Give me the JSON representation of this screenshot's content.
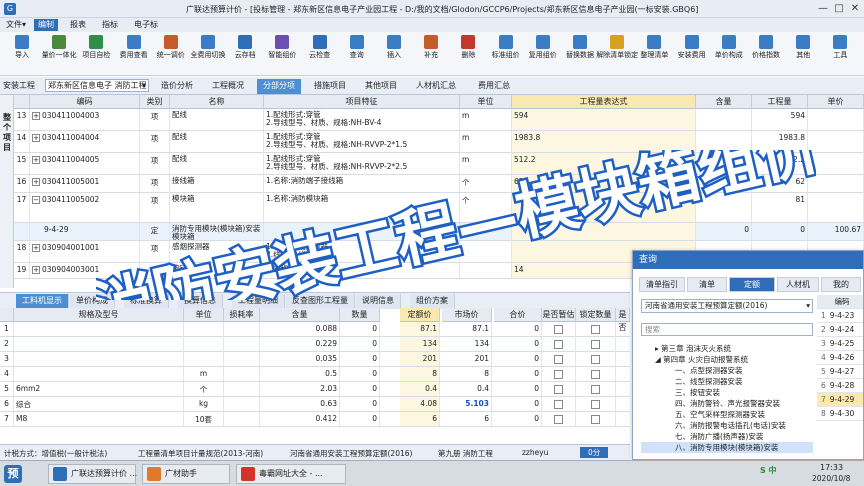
{
  "titlebar": {
    "title": "广联达预算计价 - [投标管理 - 郑东新区信息电子产业园工程 - D:/我的文档/Glodon/GCCP6/Projects/郑东新区信息电子产业园(一标安装.GBQ6]",
    "min": "—",
    "max": "□",
    "close": "✕"
  },
  "menu": [
    "文件▾",
    "编制",
    "报表",
    "指标",
    "电子标"
  ],
  "toolbar": [
    {
      "label": "导入",
      "icon": "import-icon",
      "color": "#3b7cc7"
    },
    {
      "label": "量价一体化",
      "icon": "integration-icon",
      "color": "#4a8a3c"
    },
    {
      "label": "项目自检",
      "icon": "check-icon",
      "color": "#2f8f46"
    },
    {
      "label": "费用查看",
      "icon": "view-icon",
      "color": "#3b7cc7"
    },
    {
      "label": "统一调价",
      "icon": "price-icon",
      "color": "#c55a2a"
    },
    {
      "label": "全费用切换",
      "icon": "switch-icon",
      "color": "#3b7cc7"
    },
    {
      "label": "云存档",
      "icon": "cloud-save-icon",
      "color": "#2f6db8"
    },
    {
      "label": "智能组价",
      "icon": "smart-icon",
      "color": "#6a4fb5"
    },
    {
      "label": "云检查",
      "icon": "cloud-check-icon",
      "color": "#2f6db8"
    },
    {
      "label": "查询",
      "icon": "query-icon",
      "color": "#3b7cc7"
    },
    {
      "label": "插入",
      "icon": "insert-icon",
      "color": "#3b7cc7"
    },
    {
      "label": "补充",
      "icon": "supplement-icon",
      "color": "#c55a2a"
    },
    {
      "label": "删除",
      "icon": "delete-icon",
      "color": "#c0392b"
    },
    {
      "label": "标准组价",
      "icon": "standard-icon",
      "color": "#3b7cc7"
    },
    {
      "label": "复用组价",
      "icon": "reuse-icon",
      "color": "#3b7cc7"
    },
    {
      "label": "替换数据",
      "icon": "replace-icon",
      "color": "#3b7cc7"
    },
    {
      "label": "解除清单锁定",
      "icon": "unlock-icon",
      "color": "#d8a020"
    },
    {
      "label": "整理清单",
      "icon": "sort-icon",
      "color": "#3b7cc7"
    },
    {
      "label": "安装费用",
      "icon": "install-fee-icon",
      "color": "#3b7cc7"
    },
    {
      "label": "单价构成",
      "icon": "price-build-icon",
      "color": "#3b7cc7"
    },
    {
      "label": "价格指数",
      "icon": "index-icon",
      "color": "#3b7cc7"
    },
    {
      "label": "其他",
      "icon": "other-icon",
      "color": "#3b7cc7"
    },
    {
      "label": "工具",
      "icon": "tools-icon",
      "color": "#3b7cc7"
    }
  ],
  "breadcrumb": {
    "root": "安装工程",
    "current": "郑东新区信息电子 消防工程"
  },
  "page_tabs": [
    "造价分析",
    "工程概况",
    "分部分项",
    "措施项目",
    "其他项目",
    "人材机汇总",
    "费用汇总"
  ],
  "left_rail": "整个项目",
  "grid": {
    "headers": [
      "",
      "编码",
      "类别",
      "名称",
      "项目特征",
      "单位",
      "工程量表达式",
      "含量",
      "工程量",
      "单价"
    ],
    "rows": [
      {
        "no": "13",
        "code": "030411004003",
        "cat": "项",
        "name": "配线",
        "feat": "1.配线形式:穿管\n2.导线型号、材质、规格:NH-BV-4",
        "unit": "m",
        "expr": "594",
        "content": "",
        "qty": "594",
        "price": ""
      },
      {
        "no": "14",
        "code": "030411004004",
        "cat": "项",
        "name": "配线",
        "feat": "1.配线形式:穿管\n2.导线型号、材质、规格:NH-RVVP-2*1.5",
        "unit": "m",
        "expr": "1983.8",
        "content": "",
        "qty": "1983.8",
        "price": ""
      },
      {
        "no": "15",
        "code": "030411004005",
        "cat": "项",
        "name": "配线",
        "feat": "1.配线形式:穿管\n2.导线型号、材质、规格:NH-RVVP-2*2.5",
        "unit": "m",
        "expr": "512.2",
        "content": "",
        "qty": "512.2",
        "price": ""
      },
      {
        "no": "16",
        "code": "030411005001",
        "cat": "项",
        "name": "接线箱",
        "feat": "1.名称:消防端子接线箱",
        "unit": "个",
        "expr": "62",
        "content": "",
        "qty": "62",
        "price": ""
      },
      {
        "no": "17",
        "code": "030411005002",
        "cat": "项",
        "name": "模块箱",
        "feat": "1.名称:消防模块箱",
        "unit": "个",
        "expr": "81",
        "content": "",
        "qty": "81",
        "price": ""
      },
      {
        "no": "",
        "code": "9-4-29",
        "cat": "定",
        "name": "消防专用模块(模块箱)安装 模块箱",
        "feat": "",
        "unit": "",
        "expr": "",
        "content": "0",
        "qty": "0",
        "price": "100.67"
      },
      {
        "no": "18",
        "code": "030904001001",
        "cat": "项",
        "name": "感烟探测器",
        "feat": "1.名称:感烟探测器\n2.线制:总线制",
        "unit": "",
        "expr": "",
        "content": "",
        "qty": "",
        "price": ""
      },
      {
        "no": "19",
        "code": "030904003001",
        "cat": "项",
        "name": "按钮",
        "feat": "1.名称:带电话插孔",
        "unit": "",
        "expr": "14",
        "content": "",
        "qty": "",
        "price": ""
      }
    ]
  },
  "bottom_tabs": [
    "工料机显示",
    "单价构成",
    "标准换算",
    "换算信息",
    "工程量明细",
    "反查图形工程量",
    "说明信息",
    "组价方案"
  ],
  "subgrid": {
    "headers": [
      "",
      "规格及型号",
      "单位",
      "损耗率",
      "含量",
      "数量",
      "定额价",
      "市场价",
      "合价",
      "是否暂估",
      "锁定数量",
      "是否"
    ],
    "rows": [
      {
        "no": "1",
        "spec": "",
        "unit": "",
        "loss": "",
        "content": "0.088",
        "qty": "0",
        "quota": "87.1",
        "market": "87.1",
        "total": "0"
      },
      {
        "no": "2",
        "spec": "",
        "unit": "",
        "loss": "",
        "content": "0.229",
        "qty": "0",
        "quota": "134",
        "market": "134",
        "total": "0"
      },
      {
        "no": "3",
        "spec": "",
        "unit": "",
        "loss": "",
        "content": "0.035",
        "qty": "0",
        "quota": "201",
        "market": "201",
        "total": "0"
      },
      {
        "no": "4",
        "spec": "",
        "unit": "m",
        "loss": "",
        "content": "0.5",
        "qty": "0",
        "quota": "8",
        "market": "8",
        "total": "0"
      },
      {
        "no": "5",
        "spec": "6mm2",
        "unit": "个",
        "loss": "",
        "content": "2.03",
        "qty": "0",
        "quota": "0.4",
        "market": "0.4",
        "total": "0"
      },
      {
        "no": "6",
        "spec": "综合",
        "unit": "kg",
        "loss": "",
        "content": "0.63",
        "qty": "0",
        "quota": "4.08",
        "market": "5.103",
        "total": "0"
      },
      {
        "no": "7",
        "spec": "M8",
        "unit": "10套",
        "loss": "",
        "content": "0.412",
        "qty": "0",
        "quota": "6",
        "market": "6",
        "total": "0"
      }
    ]
  },
  "status": {
    "tax": "计税方式：增值税(一般计税法)",
    "list_spec": "工程量清单项目计量规范(2013-河南)",
    "quota_lib": "河南省通用安装工程预算定额(2016)",
    "chapter": "第九册 消防工程",
    "user": "zzheyu",
    "score": "0分"
  },
  "query_panel": {
    "title": "查询",
    "tabs": [
      "清单指引",
      "清单",
      "定额",
      "人材机",
      "我的"
    ],
    "library": "河南省通用安装工程预算定额(2016)",
    "search_placeholder": "搜索",
    "tree": [
      "▸ 第三章 泡沫灭火系统",
      "◢ 第四章 火灾自动报警系统",
      "一、点型探测器安装",
      "二、线型探测器安装",
      "三、按钮安装",
      "四、消防警铃、声光报警器安装",
      "五、空气采样型探测器安装",
      "六、消防报警电话插孔(电话)安装",
      "七、消防广播(扬声器)安装",
      "八、消防专用模块(模块箱)安装"
    ],
    "code_header": "编码",
    "codes": [
      "9-4-23",
      "9-4-24",
      "9-4-25",
      "9-4-26",
      "9-4-27",
      "9-4-28",
      "9-4-29",
      "9-4-30"
    ],
    "row_nums": [
      "1",
      "2",
      "3",
      "4",
      "5",
      "6",
      "7",
      "8"
    ]
  },
  "overlay_title": "消防安装工程—模块箱组价",
  "taskbar": {
    "items": [
      "广联达预算计价 ...",
      "广材助手",
      "毒霸网址大全 - ..."
    ],
    "time": "17:33",
    "date": "2020/10/8",
    "ime": "S 中"
  },
  "colors": {
    "accent": "#2d6fb7",
    "overlay_fill": "#ffffff",
    "overlay_stroke": "#1e5fc4",
    "highlight": "#f9e9b0"
  }
}
